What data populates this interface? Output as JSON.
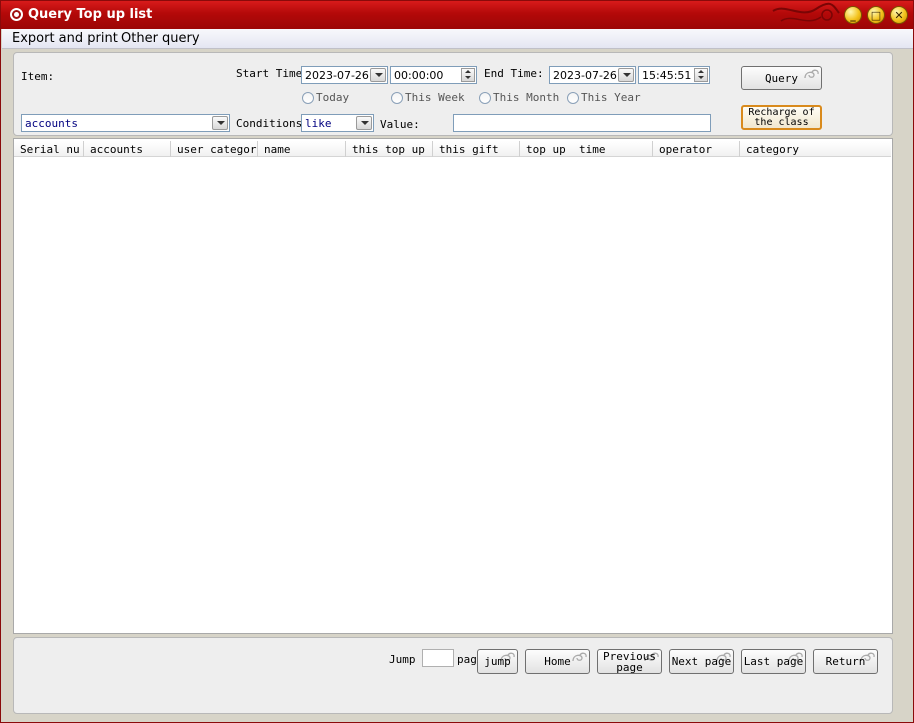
{
  "window": {
    "title": "Query Top up list",
    "accent": "#b30909"
  },
  "menu": [
    "Export and print",
    "Other query"
  ],
  "filters": {
    "item_label": "Item:",
    "start_time_label": "Start Time:",
    "start_date": "2023-07-26",
    "start_time": "00:00:00",
    "end_time_label": "End Time:",
    "end_date": "2023-07-26",
    "end_time": "15:45:51",
    "periods": [
      "Today",
      "This Week",
      "This Month",
      "This Year"
    ],
    "item_value": "accounts",
    "conditions_label": "Conditions",
    "condition_value": "like",
    "value_label": "Value:",
    "value_input": ""
  },
  "buttons": {
    "query": "Query",
    "recharge": "Recharge of the class"
  },
  "table": {
    "columns": [
      "Serial nu",
      "accounts",
      "user category",
      "name",
      "this top up",
      "this gift",
      "top up  time",
      "operator",
      "category"
    ],
    "rows": []
  },
  "pager": {
    "jump_label": "Jump",
    "page_input": "",
    "page_suffix": "pag",
    "jump": "jump",
    "home": "Home",
    "previous": "Previous page",
    "next": "Next page",
    "last": "Last page",
    "return": "Return"
  }
}
